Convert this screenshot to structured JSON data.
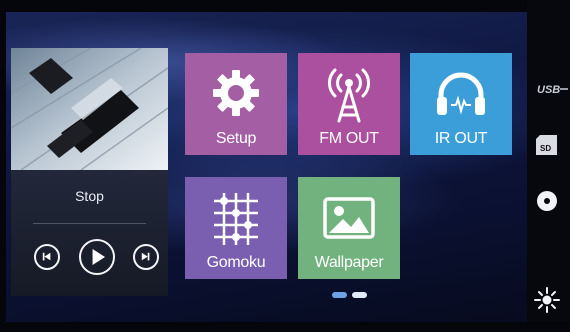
{
  "player": {
    "status": "Stop",
    "controls": [
      {
        "name": "previous-track",
        "icon": "skip-previous-icon"
      },
      {
        "name": "play",
        "icon": "play-icon"
      },
      {
        "name": "next-track",
        "icon": "skip-next-icon"
      }
    ]
  },
  "tiles": [
    {
      "label": "Setup",
      "icon": "gear-icon",
      "color": "#a45ea4"
    },
    {
      "label": "FM OUT",
      "icon": "radio-tower-icon",
      "color": "#ab4f9f"
    },
    {
      "label": "IR OUT",
      "icon": "headphones-icon",
      "color": "#3b9ed8"
    },
    {
      "label": "Gomoku",
      "icon": "game-grid-icon",
      "color": "#7a5fb1"
    },
    {
      "label": "Wallpaper",
      "icon": "image-icon",
      "color": "#72b27f"
    }
  ],
  "pagination": {
    "pages": 2,
    "current": 1
  },
  "rail": {
    "usb_label": "USB",
    "sd_label": "SD",
    "items": [
      "usb-icon",
      "sd-card-icon",
      "disc-icon",
      "brightness-icon"
    ]
  }
}
